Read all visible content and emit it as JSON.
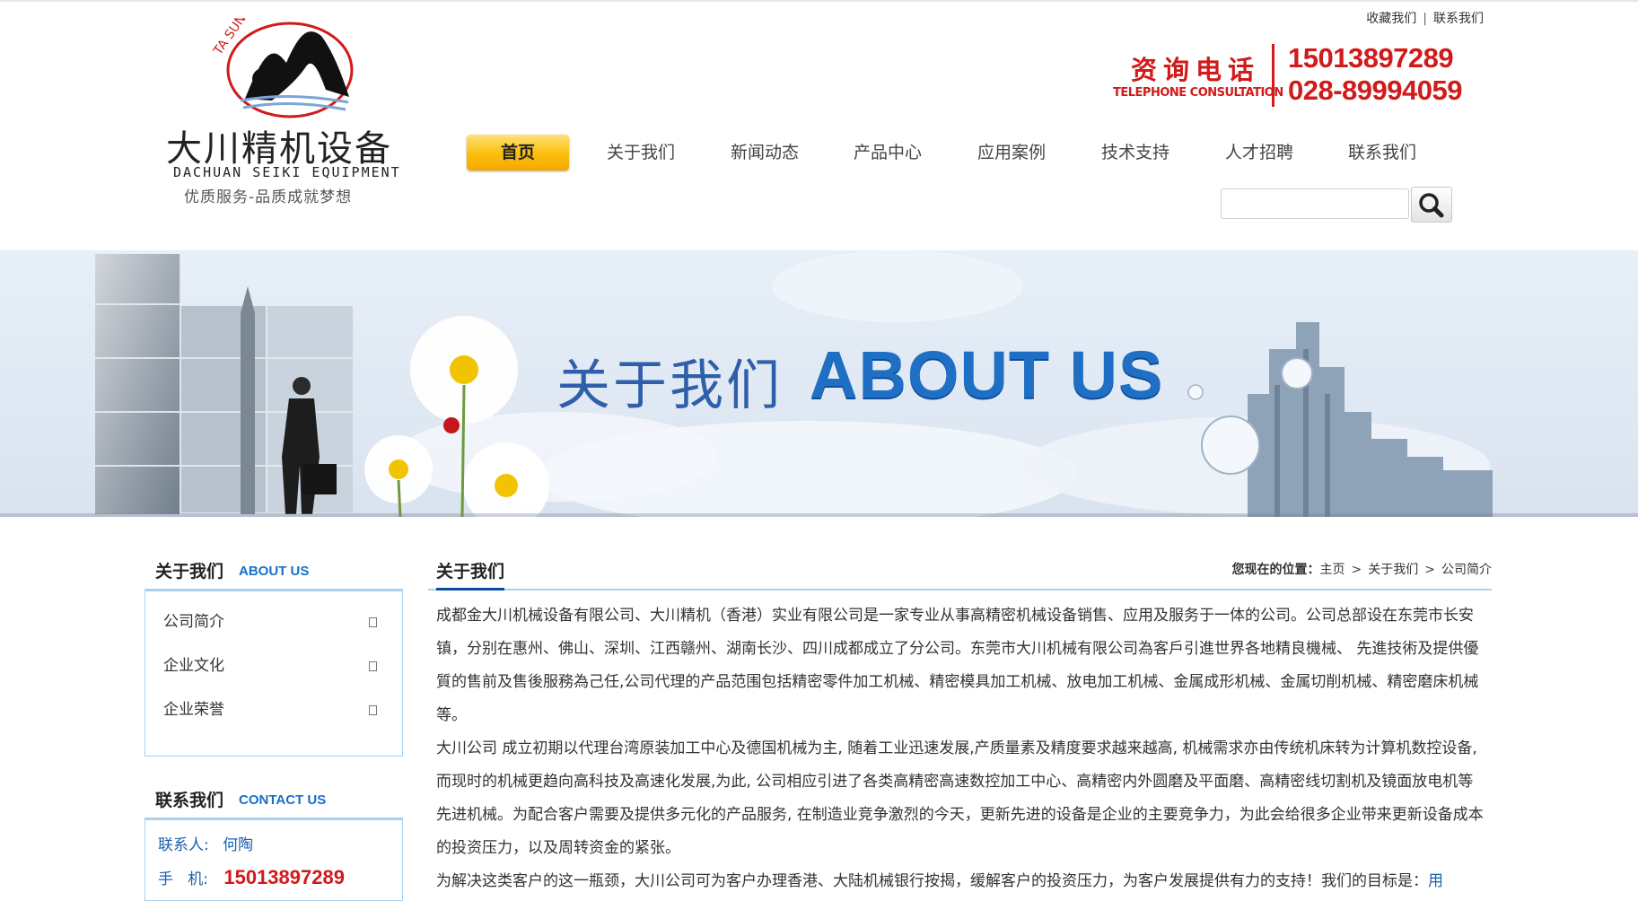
{
  "header": {
    "logo": {
      "ring_text": "TA SUN",
      "name_cn": "大川精机设备",
      "name_en": "DACHUAN SEIKI EQUIPMENT",
      "slogan": "优质服务-品质成就梦想"
    },
    "top_links": [
      "收藏我们",
      "联系我们"
    ],
    "top_sep": "|",
    "phone": {
      "label_cn": "资询电话",
      "label_en": "TELEPHONE CONSULTATION",
      "numbers": [
        "15013897289",
        "028-89994059"
      ]
    },
    "nav": [
      {
        "label": "首页",
        "active": true
      },
      {
        "label": "关于我们"
      },
      {
        "label": "新闻动态"
      },
      {
        "label": "产品中心"
      },
      {
        "label": "应用案例"
      },
      {
        "label": "技术支持"
      },
      {
        "label": "人才招聘"
      },
      {
        "label": "联系我们"
      }
    ],
    "search": {
      "placeholder": "",
      "icon": "search-icon"
    }
  },
  "banner": {
    "title_cn": "关于我们",
    "title_en": "ABOUT US"
  },
  "sidebar": {
    "about": {
      "title_cn": "关于我们",
      "title_en": "ABOUT US",
      "items": [
        "公司简介",
        "企业文化",
        "企业荣誉"
      ]
    },
    "contact": {
      "title_cn": "联系我们",
      "title_en": "CONTACT US",
      "person_label": "联系人:",
      "person_value": "何陶",
      "mobile_label": "手   机:",
      "mobile_value": "15013897289"
    }
  },
  "main": {
    "title": "关于我们",
    "breadcrumb_prefix": "您现在的位置：",
    "breadcrumb": [
      "主页",
      "关于我们",
      "公司简介"
    ],
    "paragraphs": [
      "成都金大川机械设备有限公司、大川精机（香港）实业有限公司是一家专业从事高精密机械设备销售、应用及服务于一体的公司。公司总部设在东莞市长安镇，分别在惠州、佛山、深圳、江西赣州、湖南长沙、四川成都成立了分公司。东莞市大川机械有限公司為客戶引進世界各地精良機械、 先進技術及提供優質的售前及售後服務為己任,公司代理的产品范围包括精密零件加工机械、精密模具加工机械、放电加工机械、金属成形机械、金属切削机械、精密磨床机械等。",
      "大川公司 成立初期以代理台湾原装加工中心及德国机械为主, 随着工业迅速发展,产质量素及精度要求越来越高, 机械需求亦由传统机床转为计算机数控设备, 而现时的机械更趋向高科技及高速化发展,为此, 公司相应引进了各类高精密高速数控加工中心、高精密内外圆磨及平面磨、高精密线切割机及镜面放电机等先进机械。为配合客户需要及提供多元化的产品服务, 在制造业竞争激烈的今天，更新先进的设备是企业的主要竞争力，为此会给很多企业带来更新设备成本的投资压力，以及周转资金的紧张。"
    ],
    "para3_text": "为解决这类客户的这一瓶颈，大川公司可为客户办理香港、大陆机械银行按揭，缓解客户的投资压力，为客户发展提供有力的支持！我们的目标是：",
    "para3_link": "用"
  },
  "colors": {
    "accent_blue": "#1a6fc7",
    "phone_red": "#d11a1a",
    "nav_active": "#fbbd0c",
    "border_light_blue": "#a8d0f0"
  }
}
